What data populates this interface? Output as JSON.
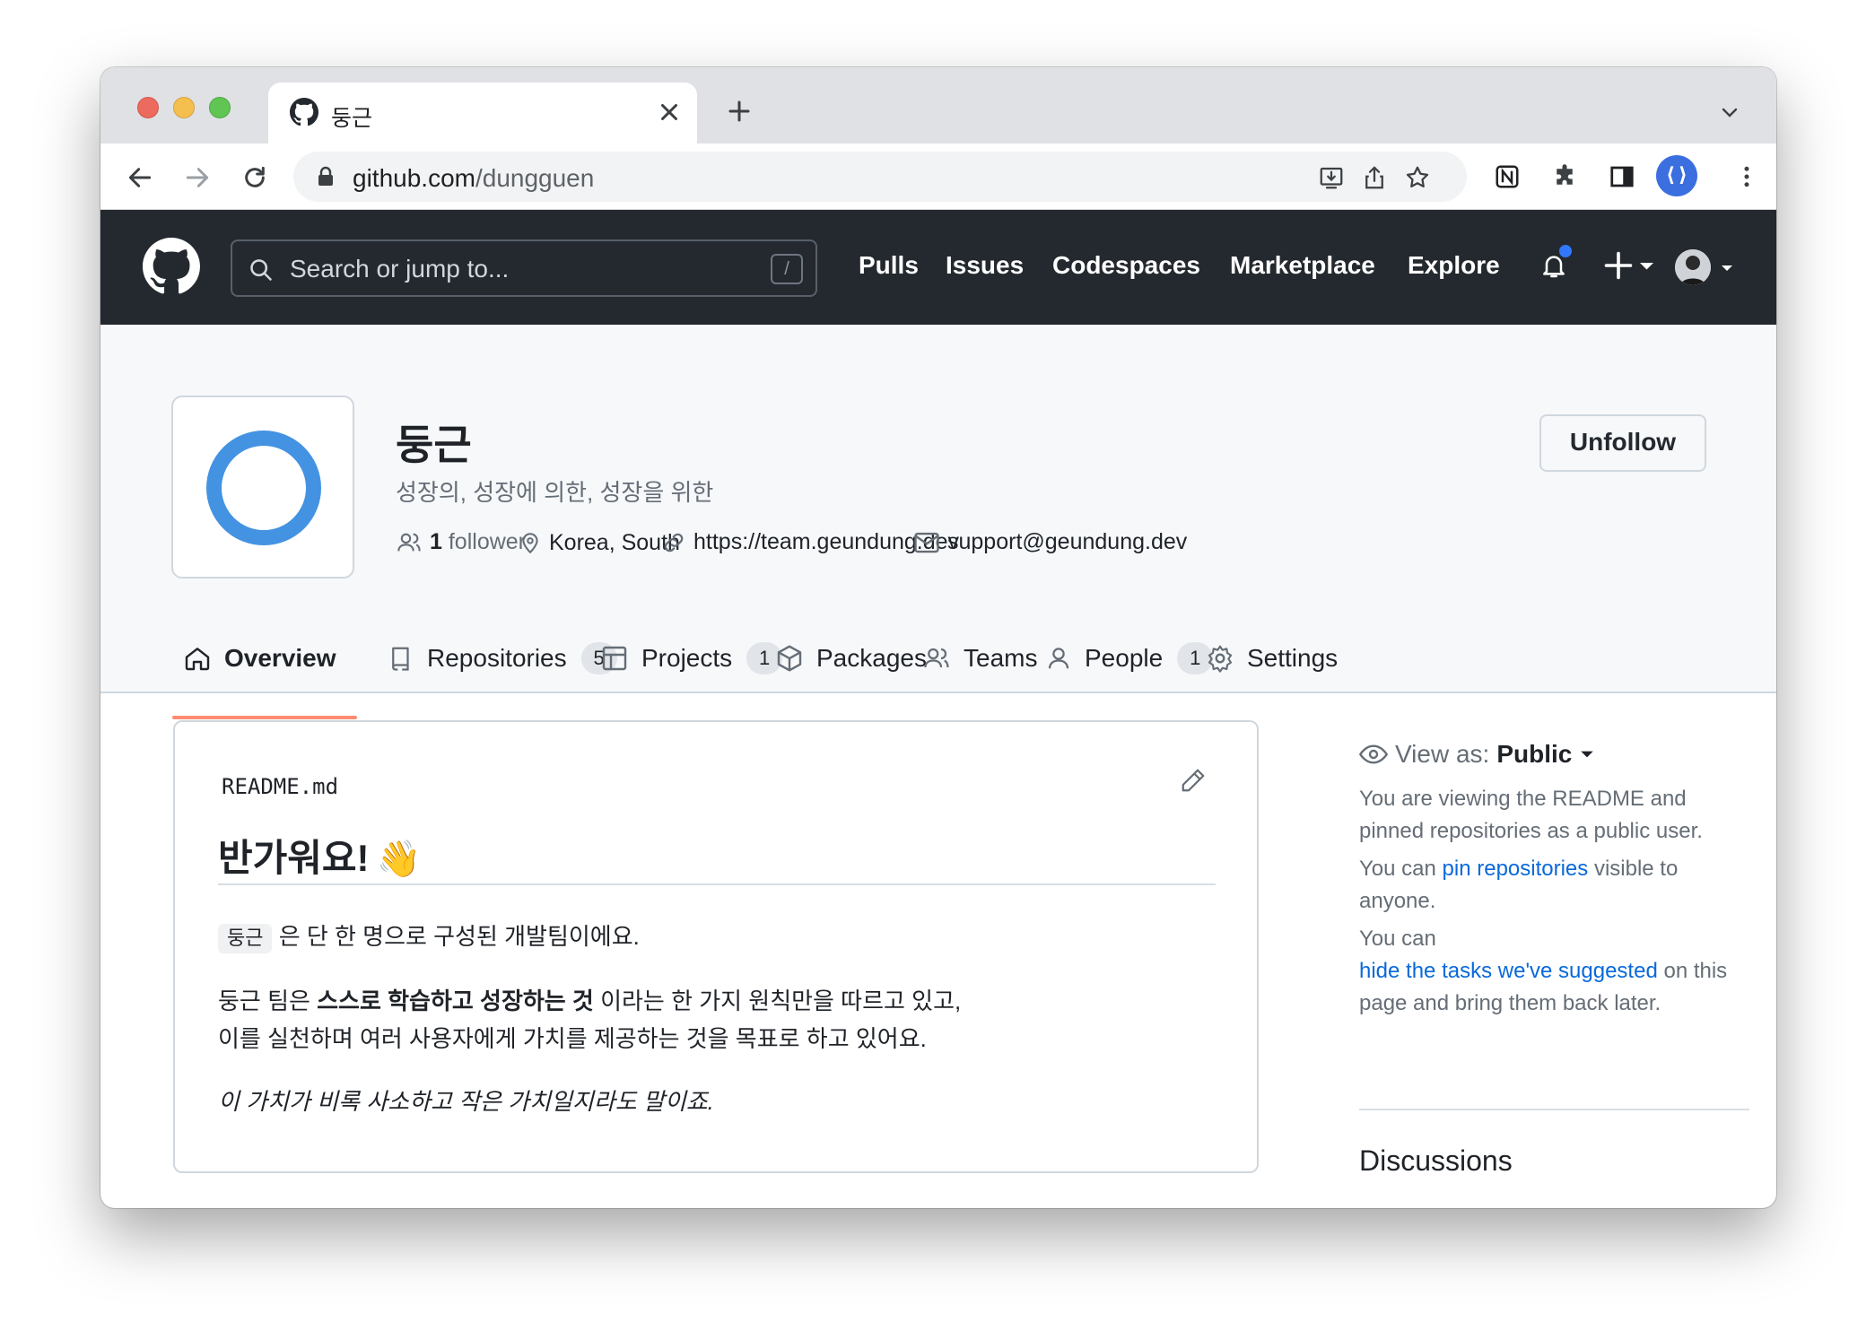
{
  "browser": {
    "tab_title": "둥근",
    "url_domain": "github.com",
    "url_path": "/dungguen",
    "extension_avatar": "⟨⟩"
  },
  "github": {
    "search_placeholder": "Search or jump to...",
    "search_shortcut": "/",
    "nav": [
      "Pulls",
      "Issues",
      "Codespaces",
      "Marketplace",
      "Explore"
    ],
    "notification_color": "#3178ff"
  },
  "profile": {
    "name": "둥근",
    "description": "성장의, 성장에 의한, 성장을 위한",
    "followers_count": "1",
    "followers_label": "follower",
    "location": "Korea, South",
    "website": "https://team.geundung.dev",
    "email": "support@geundung.dev",
    "unfollow_label": "Unfollow",
    "avatar_color": "#4493e2"
  },
  "tabs": [
    {
      "label": "Overview",
      "icon": "home-icon",
      "count": null
    },
    {
      "label": "Repositories",
      "icon": "repo-icon",
      "count": "5"
    },
    {
      "label": "Projects",
      "icon": "project-icon",
      "count": "1"
    },
    {
      "label": "Packages",
      "icon": "package-icon",
      "count": null
    },
    {
      "label": "Teams",
      "icon": "people-icon",
      "count": null
    },
    {
      "label": "People",
      "icon": "person-icon",
      "count": "1"
    },
    {
      "label": "Settings",
      "icon": "gear-icon",
      "count": null
    }
  ],
  "readme": {
    "filename": "README.md",
    "heading": "반가워요!",
    "heading_emoji": "👋",
    "code_inline": "둥근",
    "line1_rest": "은 단 한 명으로 구성된 개발팀이에요.",
    "line2_pre": "둥근 팀은 ",
    "line2_bold": "스스로 학습하고 성장하는 것",
    "line2_post": " 이라는 한 가지 원칙만을 따르고 있고,",
    "line3": "이를 실천하며 여러 사용자에게 가치를 제공하는 것을 목표로 하고 있어요.",
    "line4": "이 가치가 비록 사소하고 작은 가치일지라도 말이죠."
  },
  "sidebar": {
    "view_as_label": "View as:",
    "view_as_value": "Public",
    "para1": "You are viewing the README and pinned repositories as a public user.",
    "para2_pre": "You can ",
    "para2_link": "pin repositories",
    "para2_post": " visible to anyone.",
    "para3_pre": "You can",
    "para3_link": "hide the tasks we've suggested",
    "para3_post": " on this page and bring them back later.",
    "discussions": "Discussions"
  }
}
